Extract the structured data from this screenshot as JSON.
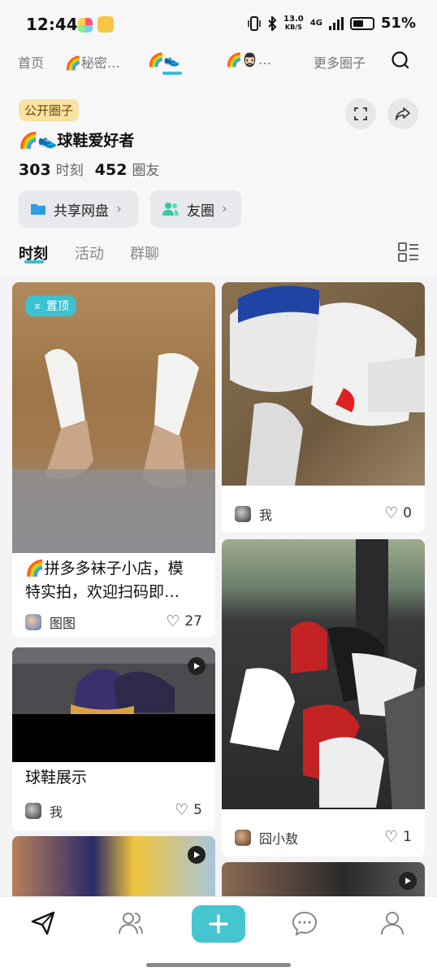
{
  "status_bar": {
    "time": "12:44",
    "net_speed": "13.0",
    "net_unit": "KB/S",
    "net_type": "4G",
    "battery": "51%"
  },
  "top_tabs": [
    {
      "label": "首页",
      "active": false
    },
    {
      "label": "🌈秘密…",
      "active": false
    },
    {
      "label": "🌈👟",
      "active": true
    },
    {
      "label": "🌈🧔🏻‍♂️…",
      "active": false
    },
    {
      "label": "更多圈子",
      "active": false
    }
  ],
  "circle": {
    "badge": "公开圈子",
    "name": "🌈👟球鞋爱好者",
    "moments_count": "303",
    "moments_label": "时刻",
    "members_count": "452",
    "members_label": "圈友"
  },
  "quick_links": [
    {
      "label": "共享网盘",
      "icon": "folder-icon"
    },
    {
      "label": "友圈",
      "icon": "users-icon"
    }
  ],
  "sub_tabs": [
    {
      "label": "时刻",
      "active": true
    },
    {
      "label": "活动",
      "active": false
    },
    {
      "label": "群聊",
      "active": false
    }
  ],
  "posts": [
    {
      "pinned_label": "置顶",
      "title_line1": "🌈拼多多袜子小店，模",
      "title_line2": "特实拍，欢迎扫码即…",
      "author": "图图",
      "likes": "27"
    },
    {
      "title": "",
      "author": "我",
      "likes": "0"
    },
    {
      "title": "球鞋展示",
      "author": "我",
      "likes": "5",
      "video": true
    },
    {
      "title": "",
      "author": "囧小敖",
      "likes": "1"
    }
  ],
  "bottom_nav": [
    "send-icon",
    "people-icon",
    "add-icon",
    "chat-icon",
    "profile-icon"
  ],
  "colors": {
    "accent": "#3bc1cf",
    "badge_bg": "#fbe1a4",
    "page_bg": "#f4f4f6"
  }
}
